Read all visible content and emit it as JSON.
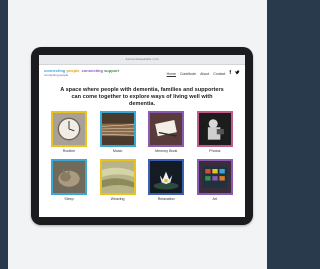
{
  "browser": {
    "url": "dementiawebsite.com"
  },
  "site": {
    "logo_words": [
      "connecting",
      "people,",
      "connecting",
      "support"
    ],
    "tagline": "connecting people"
  },
  "nav": {
    "items": [
      "Home",
      "Contribute",
      "About",
      "Contact"
    ],
    "active": "Home"
  },
  "headline": "A space where people with dementia, families and supporters can come together to explore ways of living well with dementia.",
  "tiles": [
    {
      "label": "Routine",
      "color": "#e8c21e",
      "icon": "clock-icon"
    },
    {
      "label": "Music",
      "color": "#3aa7d6",
      "icon": "guitar-icon"
    },
    {
      "label": "Memory Book",
      "color": "#8a5ab4",
      "icon": "book-icon"
    },
    {
      "label": "Photos",
      "color": "#c45a8a",
      "icon": "camera-icon"
    },
    {
      "label": "Sleep",
      "color": "#3aa7d6",
      "icon": "cat-icon"
    },
    {
      "label": "Weaving",
      "color": "#e8c21e",
      "icon": "weaving-icon"
    },
    {
      "label": "Relaxation",
      "color": "#3b5fb4",
      "icon": "lotus-icon"
    },
    {
      "label": "Art",
      "color": "#8a5ab4",
      "icon": "paint-icon"
    }
  ],
  "colors": {
    "background": "#2a3a4d",
    "card": "#f2f3f5",
    "tablet": "#1b1c1f"
  }
}
